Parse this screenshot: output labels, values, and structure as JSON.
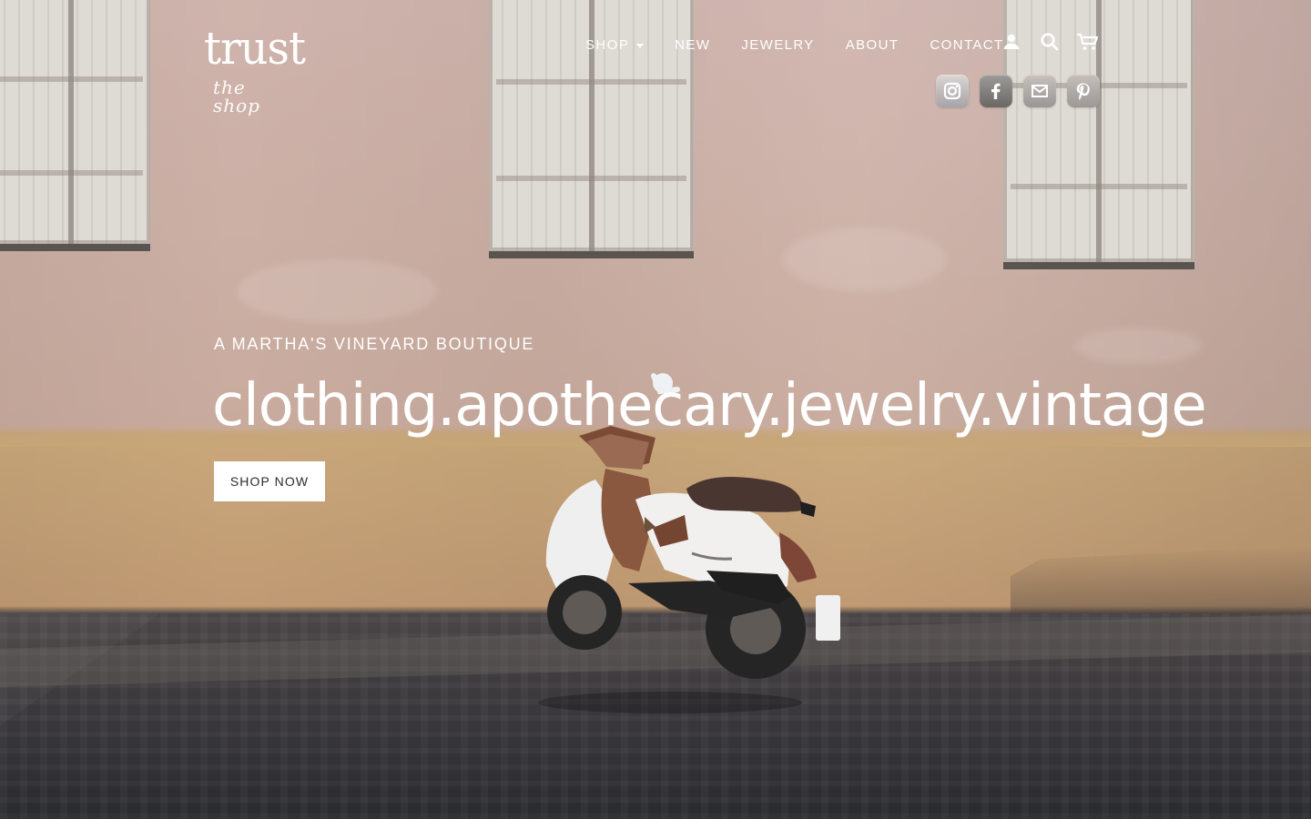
{
  "header": {
    "logo_text": "trust",
    "logo_subtext": "the shop",
    "nav": [
      {
        "label": "SHOP",
        "has_dropdown": true
      },
      {
        "label": "NEW"
      },
      {
        "label": "JEWELRY"
      },
      {
        "label": "ABOUT"
      },
      {
        "label": "CONTACT"
      }
    ],
    "tool_icons": [
      {
        "name": "account-icon"
      },
      {
        "name": "search-icon"
      },
      {
        "name": "cart-icon"
      }
    ],
    "social_icons": [
      {
        "name": "instagram-icon"
      },
      {
        "name": "facebook-icon"
      },
      {
        "name": "email-icon"
      },
      {
        "name": "pinterest-icon"
      }
    ]
  },
  "hero": {
    "eyebrow": "A MARTHA'S VINEYARD BOUTIQUE",
    "headline": "clothing.apothecary.jewelry.vintage",
    "cta_label": "SHOP NOW"
  },
  "colors": {
    "text_light": "#ffffff",
    "button_bg": "#ffffff",
    "button_text": "#2d2c2b"
  }
}
